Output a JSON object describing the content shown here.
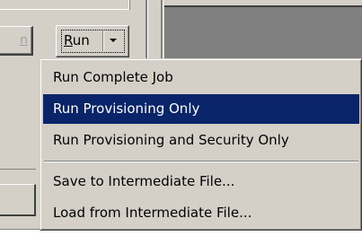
{
  "partial_button": {
    "label": "n"
  },
  "run_button": {
    "label_mnemonic": "R",
    "label_rest": "un"
  },
  "menu": {
    "items": [
      {
        "label": "Run Complete Job",
        "selected": false
      },
      {
        "label": "Run Provisioning Only",
        "selected": true
      },
      {
        "label": "Run Provisioning and Security Only",
        "selected": false
      },
      {
        "label": "Save to Intermediate File...",
        "selected": false
      },
      {
        "label": "Load from Intermediate File...",
        "selected": false
      }
    ]
  },
  "colors": {
    "face": "#d4d0c8",
    "highlight": "#0a246a",
    "shadow": "#808080"
  }
}
